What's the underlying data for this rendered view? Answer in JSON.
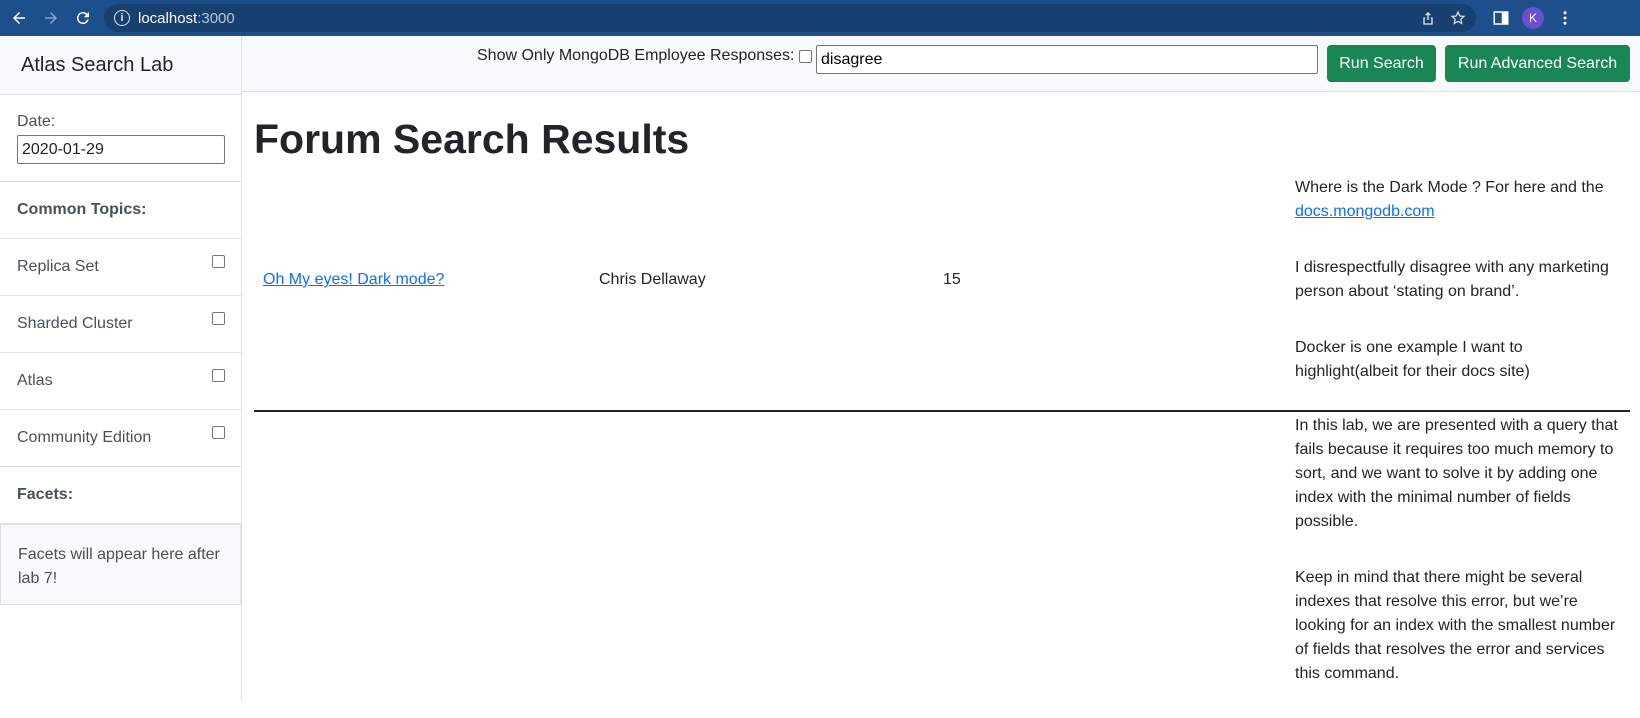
{
  "browser": {
    "url_host": "localhost",
    "url_port": ":3000",
    "profile_initial": "K"
  },
  "sidebar": {
    "brand": "Atlas Search Lab",
    "date_label": "Date:",
    "date_value": "2020-01-29",
    "common_topics_label": "Common Topics:",
    "topics": [
      {
        "label": "Replica Set",
        "checked": false
      },
      {
        "label": "Sharded Cluster",
        "checked": false
      },
      {
        "label": "Atlas",
        "checked": false
      },
      {
        "label": "Community Edition",
        "checked": false
      }
    ],
    "facets_label": "Facets:",
    "facets_placeholder": "Facets will appear here after lab 7!"
  },
  "toolbar": {
    "employee_label": "Show Only MongoDB Employee Responses:",
    "employee_checked": false,
    "search_value": "disagree",
    "run_search_label": "Run Search",
    "run_advanced_label": "Run Advanced Search"
  },
  "main": {
    "title": "Forum Search Results",
    "results": [
      {
        "title": "Oh My eyes! Dark mode?",
        "author": "Chris Dellaway",
        "score": "15",
        "para1_text": "Where is the Dark Mode ? For here and the ",
        "para1_link": "docs.mongodb.com",
        "para2": "I disrespectfully disagree with any marketing person about ‘stating on brand’.",
        "para3": "Docker is one example I want to highlight(albeit for their docs site)"
      },
      {
        "para1": "In this lab, we are presented with a query that fails because it requires too much memory to sort, and we want to solve it by adding one index with the minimal number of fields possible.",
        "para2": "Keep in mind that there might be several indexes that resolve this error, but we’re looking for an index with the smallest number of fields that resolves the error and services this command."
      }
    ]
  },
  "colors": {
    "browser_bar": "#1c4f8c",
    "button_green": "#198754",
    "link_blue": "#0d6efd"
  }
}
